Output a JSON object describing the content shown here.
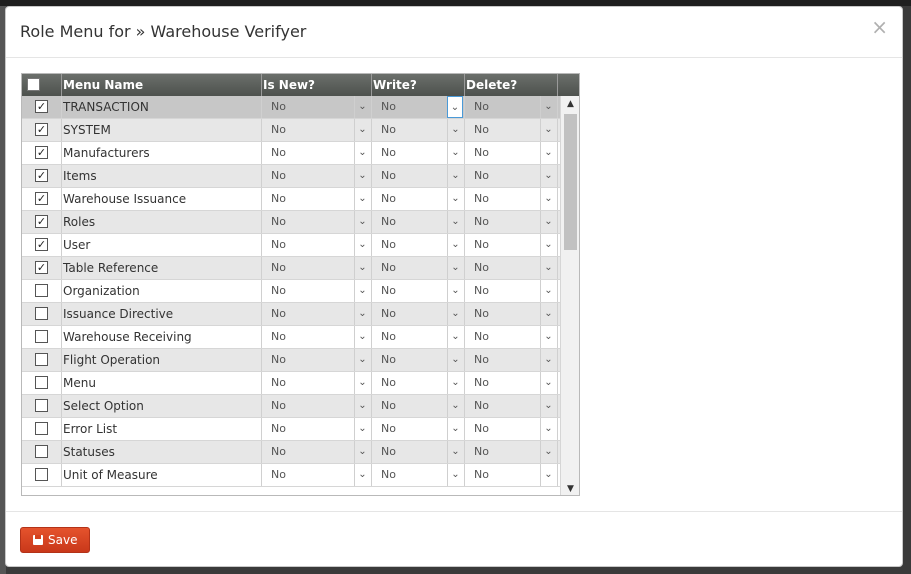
{
  "modal": {
    "title": "Role Menu for » Warehouse Verifyer",
    "close_glyph": "×"
  },
  "grid": {
    "columns": [
      "Menu Name",
      "Is New?",
      "Write?",
      "Delete?"
    ],
    "rows": [
      {
        "checked": true,
        "name": "TRANSACTION",
        "is_new": "No",
        "write": "No",
        "delete": "No"
      },
      {
        "checked": true,
        "name": "SYSTEM",
        "is_new": "No",
        "write": "No",
        "delete": "No"
      },
      {
        "checked": true,
        "name": "Manufacturers",
        "is_new": "No",
        "write": "No",
        "delete": "No"
      },
      {
        "checked": true,
        "name": "Items",
        "is_new": "No",
        "write": "No",
        "delete": "No"
      },
      {
        "checked": true,
        "name": "Warehouse Issuance",
        "is_new": "No",
        "write": "No",
        "delete": "No"
      },
      {
        "checked": true,
        "name": "Roles",
        "is_new": "No",
        "write": "No",
        "delete": "No"
      },
      {
        "checked": true,
        "name": "User",
        "is_new": "No",
        "write": "No",
        "delete": "No"
      },
      {
        "checked": true,
        "name": "Table Reference",
        "is_new": "No",
        "write": "No",
        "delete": "No"
      },
      {
        "checked": false,
        "name": "Organization",
        "is_new": "No",
        "write": "No",
        "delete": "No"
      },
      {
        "checked": false,
        "name": "Issuance Directive",
        "is_new": "No",
        "write": "No",
        "delete": "No"
      },
      {
        "checked": false,
        "name": "Warehouse Receiving",
        "is_new": "No",
        "write": "No",
        "delete": "No"
      },
      {
        "checked": false,
        "name": "Flight Operation",
        "is_new": "No",
        "write": "No",
        "delete": "No"
      },
      {
        "checked": false,
        "name": "Menu",
        "is_new": "No",
        "write": "No",
        "delete": "No"
      },
      {
        "checked": false,
        "name": "Select Option",
        "is_new": "No",
        "write": "No",
        "delete": "No"
      },
      {
        "checked": false,
        "name": "Error List",
        "is_new": "No",
        "write": "No",
        "delete": "No"
      },
      {
        "checked": false,
        "name": "Statuses",
        "is_new": "No",
        "write": "No",
        "delete": "No"
      },
      {
        "checked": false,
        "name": "Unit of Measure",
        "is_new": "No",
        "write": "No",
        "delete": "No"
      }
    ]
  },
  "footer": {
    "save_label": "Save"
  },
  "colors": {
    "header_bg": "#5b5f5b",
    "selected_row": "#c7c7c7",
    "alt_row": "#e7e7e7",
    "save_button": "#d8431f"
  }
}
